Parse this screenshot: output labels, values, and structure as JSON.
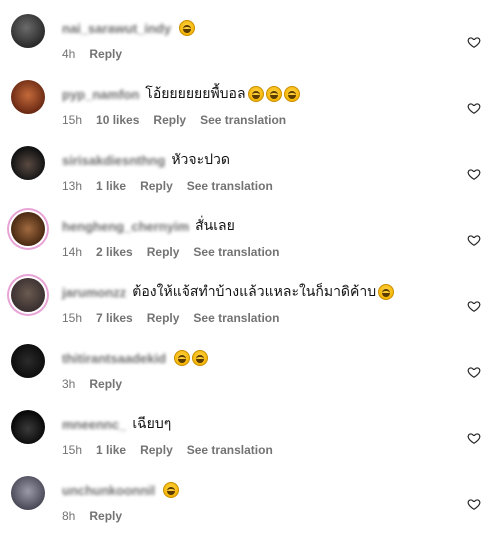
{
  "comments": [
    {
      "username": "nai_sarawut_indy",
      "text": "",
      "emojis": 1,
      "time": "4h",
      "likes": "",
      "reply": "Reply",
      "translation": ""
    },
    {
      "username": "pyp_namfon",
      "text": "โอ้ยยยยยยพื้บอล",
      "emojis": 3,
      "time": "15h",
      "likes": "10 likes",
      "reply": "Reply",
      "translation": "See translation"
    },
    {
      "username": "sirisakdiesnthng",
      "text": "หัวจะปวด",
      "emojis": 0,
      "time": "13h",
      "likes": "1 like",
      "reply": "Reply",
      "translation": "See translation"
    },
    {
      "username": "hengheng_chernyim",
      "text": "สั่นเลย",
      "emojis": 0,
      "time": "14h",
      "likes": "2 likes",
      "reply": "Reply",
      "translation": "See translation"
    },
    {
      "username": "jarumonzz",
      "text": "ต้องให้แจ้สทำบ้างแล้วแหละในก็มาดิค้าบ",
      "emojis": 1,
      "time": "15h",
      "likes": "7 likes",
      "reply": "Reply",
      "translation": "See translation"
    },
    {
      "username": "thitirantsaadekid",
      "text": "",
      "emojis": 2,
      "time": "3h",
      "likes": "",
      "reply": "Reply",
      "translation": ""
    },
    {
      "username": "mneennc_",
      "text": "เฉียบๆ",
      "emojis": 0,
      "time": "15h",
      "likes": "1 like",
      "reply": "Reply",
      "translation": "See translation"
    },
    {
      "username": "unchunkoonnil",
      "text": "",
      "emojis": 1,
      "time": "8h",
      "likes": "",
      "reply": "Reply",
      "translation": ""
    }
  ],
  "icons": {
    "like": "heart-outline-icon",
    "emoji": "tears-of-joy-emoji"
  },
  "colors": {
    "muted": "#737373",
    "text": "#111111"
  }
}
